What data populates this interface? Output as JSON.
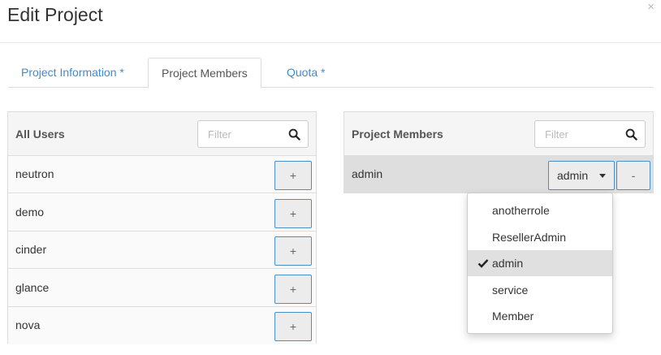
{
  "modal": {
    "title": "Edit Project",
    "close_glyph": "×"
  },
  "tabs": [
    {
      "label": "Project Information *",
      "active": false
    },
    {
      "label": "Project Members",
      "active": true
    },
    {
      "label": "Quota *",
      "active": false
    }
  ],
  "all_users": {
    "title": "All Users",
    "filter_placeholder": "Filter",
    "add_label": "+",
    "users": [
      "neutron",
      "demo",
      "cinder",
      "glance",
      "nova"
    ]
  },
  "project_members": {
    "title": "Project Members",
    "filter_placeholder": "Filter",
    "members": [
      {
        "name": "admin",
        "role": "admin",
        "remove_label": "-"
      }
    ]
  },
  "role_dropdown": {
    "options": [
      "anotherrole",
      "ResellerAdmin",
      "admin",
      "service",
      "Member"
    ],
    "selected": "admin"
  },
  "colors": {
    "link": "#428bca",
    "button_border": "#4a90c8",
    "selected_bg": "#e0e0e0"
  }
}
